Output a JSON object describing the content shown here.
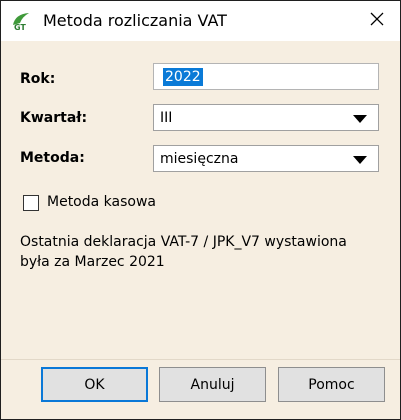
{
  "window": {
    "title": "Metoda rozliczania VAT",
    "app_icon": "gt-logo-icon",
    "close_icon": "close-icon"
  },
  "form": {
    "rok": {
      "label": "Rok:",
      "value": "2022"
    },
    "kwartal": {
      "label": "Kwartał:",
      "value": "III"
    },
    "metoda": {
      "label": "Metoda:",
      "value": "miesięczna"
    },
    "kasowa": {
      "label": "Metoda kasowa",
      "checked": false
    }
  },
  "info": {
    "line1": "Ostatnia deklaracja VAT-7 / JPK_V7 wystawiona",
    "line2": "była za Marzec 2021"
  },
  "buttons": {
    "ok": "OK",
    "cancel": "Anuluj",
    "help": "Pomoc"
  },
  "colors": {
    "dialog_bg": "#f6eee1",
    "selection": "#0a7ad7",
    "default_button_border": "#0a78d7"
  }
}
